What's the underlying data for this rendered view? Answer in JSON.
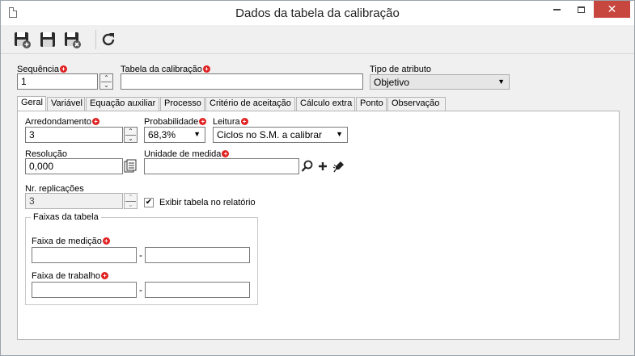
{
  "window": {
    "title": "Dados da tabela da calibração"
  },
  "toolbar": {
    "buttons": [
      {
        "icon": "save-new-icon"
      },
      {
        "icon": "save-icon"
      },
      {
        "icon": "save-close-icon"
      },
      {
        "icon": "refresh-icon"
      }
    ]
  },
  "header": {
    "sequencia_label": "Sequência",
    "sequencia_value": "1",
    "tabela_label": "Tabela da calibração",
    "tabela_value": "",
    "tipo_label": "Tipo de atributo",
    "tipo_value": "Objetivo"
  },
  "tabs": [
    "Geral",
    "Variável",
    "Equação auxiliar",
    "Processo",
    "Critério de aceitação",
    "Cálculo extra",
    "Ponto",
    "Observação"
  ],
  "geral": {
    "arredondamento_label": "Arredondamento",
    "arredondamento_value": "3",
    "probabilidade_label": "Probabilidade",
    "probabilidade_value": "68,3%",
    "leitura_label": "Leitura",
    "leitura_value": "Ciclos no S.M. a calibrar",
    "resolucao_label": "Resolução",
    "resolucao_value": "0,000",
    "unidade_label": "Unidade de medida",
    "unidade_value": "",
    "replicacoes_label": "Nr. replicações",
    "replicacoes_value": "3",
    "exibir_label": "Exibir tabela no relatório",
    "exibir_checked": true,
    "faixas_legend": "Faixas da tabela",
    "faixa_medicao_label": "Faixa de medição",
    "faixa_trabalho_label": "Faixa de trabalho",
    "faixa_medicao_min": "",
    "faixa_medicao_max": "",
    "faixa_trabalho_min": "",
    "faixa_trabalho_max": "",
    "dash": "-"
  },
  "colors": {
    "required": "#e02020",
    "close_button": "#c7463e"
  }
}
